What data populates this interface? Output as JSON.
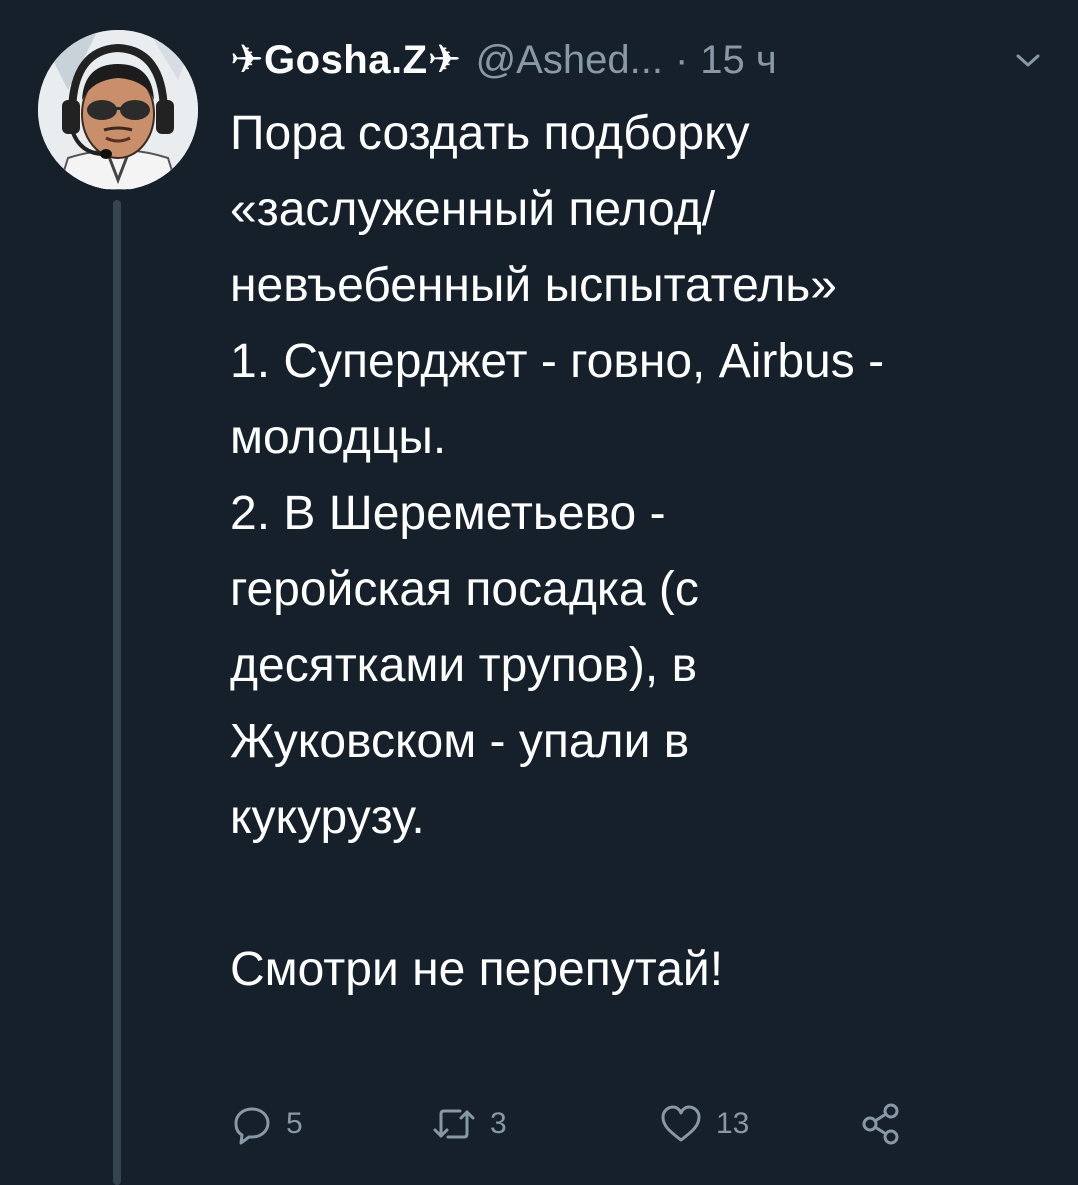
{
  "tweet": {
    "display_name": "✈Gosha.Z✈",
    "handle": "@Ashed...",
    "separator": "·",
    "time": "15 ч",
    "lines": [
      "Пора создать подборку",
      "«заслуженный пелод/",
      "невъебенный ыспытатель»",
      "1. Суперджет - говно, Airbus -",
      "молодцы.",
      "2. В Шереметьево -",
      "геройская посадка (с",
      "десятками трупов), в",
      "Жуковском - упали в",
      "кукурузу.",
      "",
      "Смотри не перепутай!"
    ]
  },
  "actions": {
    "reply_count": "5",
    "retweet_count": "3",
    "like_count": "13"
  },
  "icons": {
    "avatar": "avatar-photo",
    "menu": "chevron-down-icon",
    "reply": "reply-icon",
    "retweet": "retweet-icon",
    "like": "heart-icon",
    "share": "share-icon"
  },
  "colors": {
    "background": "#15202b",
    "text": "#ffffff",
    "secondary": "#8899a6",
    "thread_line": "#38444d"
  }
}
